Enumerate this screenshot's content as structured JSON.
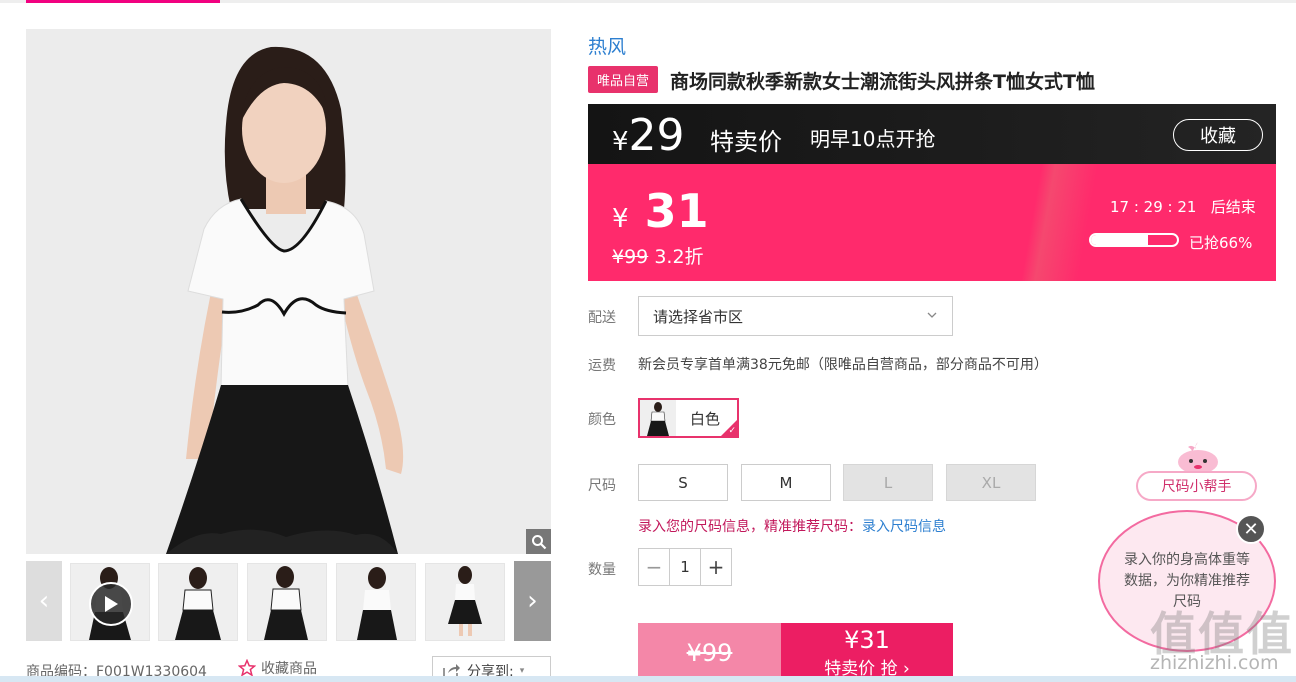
{
  "brand": "热风",
  "badge": "唯品自营",
  "title": "商场同款秋季新款女士潮流街头风拼条T恤女式T恤",
  "price_bar": {
    "currency": "¥",
    "special_price": "29",
    "special_label": "特卖价",
    "notice": "明早10点开抢",
    "collect": "收藏"
  },
  "flash": {
    "currency": "¥",
    "price": "31",
    "original": "¥99",
    "discount": "3.2折",
    "countdown": "17 : 29 : 21",
    "countdown_suffix": "后结束",
    "sold_text": "已抢66%",
    "sold_fraction": 0.66
  },
  "delivery": {
    "label": "配送",
    "placeholder": "请选择省市区"
  },
  "shipping": {
    "label": "运费",
    "text": "新会员专享首单满38元免邮（限唯品自营商品，部分商品不可用）"
  },
  "color": {
    "label": "颜色",
    "selected": "白色"
  },
  "size": {
    "label": "尺码",
    "options": [
      "S",
      "M",
      "L",
      "XL"
    ],
    "hint": "录入您的尺码信息，精准推荐尺码：",
    "hint_link": "录入尺码信息"
  },
  "quantity": {
    "label": "数量",
    "value": "1",
    "minus": "−",
    "plus": "+"
  },
  "buy": {
    "original": "¥99",
    "price": "¥31",
    "label": "特卖价 抢 ›"
  },
  "gallery": {
    "sku_line": "商品编码：F001W1330604",
    "favorite": "收藏商品",
    "share": "分享到:"
  },
  "helper": {
    "pill": "尺码小帮手",
    "bubble": "录入你的身高体重等数据，为你精准推荐尺码",
    "close": "✕"
  },
  "watermark": {
    "logo": "值值值",
    "url": "zhizhizhi.com"
  },
  "colors": {
    "accent": "#f10180",
    "flash_pink": "#ff2a6c",
    "buy_pink": "#ec1e63",
    "buy_light": "#f487a8",
    "brand_blue": "#2d7fd0"
  }
}
